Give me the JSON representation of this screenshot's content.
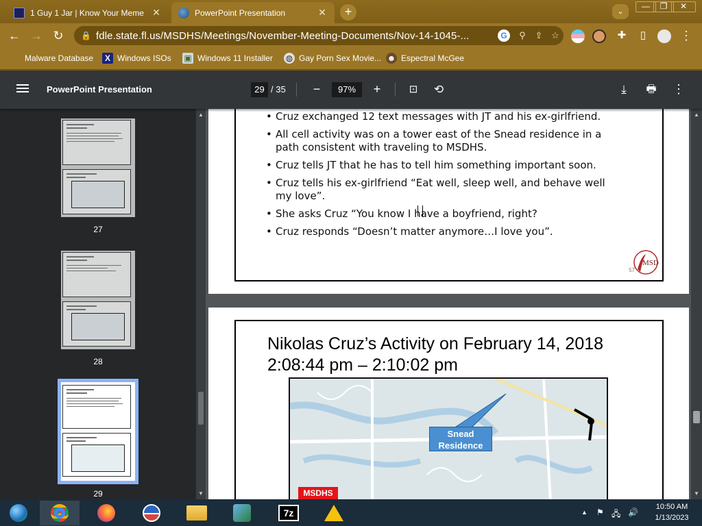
{
  "browser": {
    "tabs": [
      {
        "title": "1 Guy 1 Jar | Know Your Meme",
        "active": false
      },
      {
        "title": "PowerPoint Presentation",
        "active": true
      }
    ],
    "new_tab": "+",
    "window_controls": {
      "minimize": "—",
      "restore": "❐",
      "close": "✕"
    },
    "url": "fdle.state.fl.us/MSDHS/Meetings/November-Meeting-Documents/Nov-14-1045-...",
    "bookmarks": [
      {
        "label": "Malware Database"
      },
      {
        "label": "Windows ISOs"
      },
      {
        "label": "Windows 11 Installer"
      },
      {
        "label": "Gay Porn Sex Movie..."
      },
      {
        "label": "Espectral McGee"
      }
    ]
  },
  "pdf": {
    "title": "PowerPoint Presentation",
    "current_page": "29",
    "total_pages": "/ 35",
    "zoom": "97%",
    "zoom_out": "−",
    "zoom_in": "+"
  },
  "sidebar": {
    "thumbnails": [
      {
        "page": "27",
        "selected": false
      },
      {
        "page": "28",
        "selected": false
      },
      {
        "page": "29",
        "selected": true
      }
    ]
  },
  "slide_top": {
    "bullets": [
      "Cruz exchanged 12 text messages with JT and his ex-girlfriend.",
      "All cell activity was on a tower east of the Snead residence in a path consistent with traveling to MSDHS.",
      "Cruz tells JT that he has to tell him something important soon.",
      "Cruz tells his ex-girlfriend “Eat well, sleep well, and behave well my love”.",
      "She asks Cruz “You know I have a boyfriend, right?",
      "Cruz responds “Doesn’t matter anymore…I love you”."
    ],
    "slide_number": "57",
    "logo_text": "MSD"
  },
  "slide_next": {
    "title_line1": "Nikolas Cruz’s Activity on February 14, 2018",
    "title_line2": "2:08:44 pm – 2:10:02 pm",
    "callout_line1": "Snead",
    "callout_line2": "Residence",
    "msdhs_label": "MSDHS"
  },
  "taskbar": {
    "apps": [
      "edge-icon",
      "chrome-icon",
      "firefox-icon",
      "obama-icon",
      "file-explorer-icon",
      "network-icon",
      "7zip-icon",
      "installer-icon"
    ],
    "sevenzip_label": "7z",
    "time": "10:50 AM",
    "date": "1/13/2023"
  }
}
